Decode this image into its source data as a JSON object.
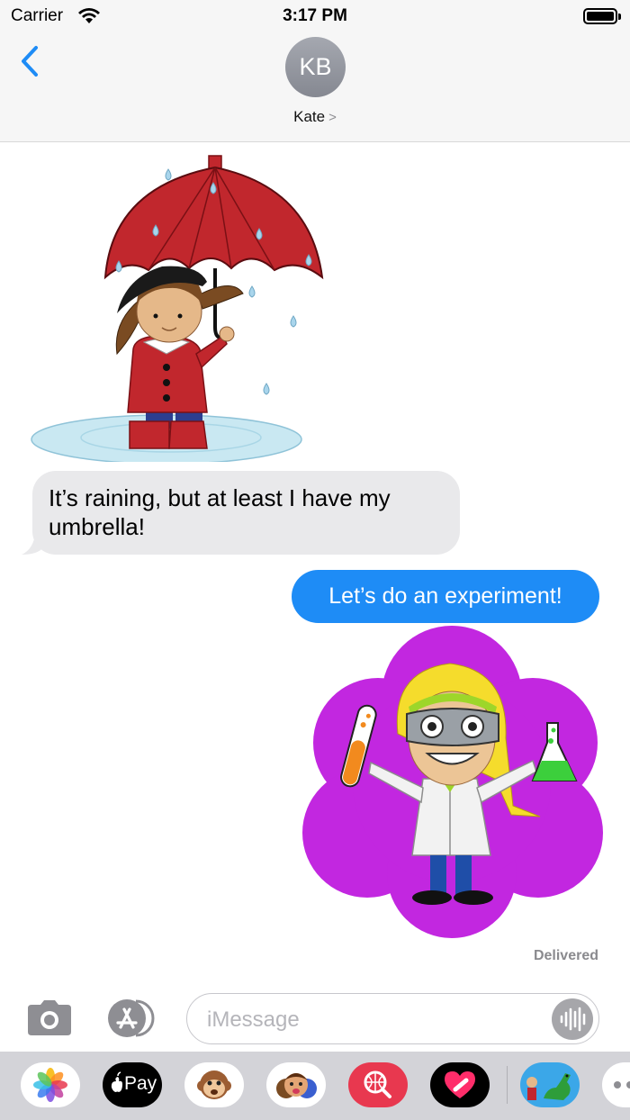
{
  "status_bar": {
    "carrier": "Carrier",
    "time": "3:17 PM"
  },
  "header": {
    "avatar_initials": "KB",
    "contact_name": "Kate",
    "chevron": ">"
  },
  "messages": [
    {
      "type": "sticker",
      "direction": "incoming",
      "subject": "girl-with-umbrella"
    },
    {
      "type": "text",
      "direction": "incoming",
      "text": "It’s raining,  but at least I have my umbrella!"
    },
    {
      "type": "text",
      "direction": "outgoing",
      "text": "Let’s do an experiment!"
    },
    {
      "type": "sticker",
      "direction": "outgoing",
      "subject": "scientist-girl"
    }
  ],
  "status": {
    "delivered": "Delivered"
  },
  "compose": {
    "placeholder": "iMessage"
  },
  "app_drawer": {
    "apps": [
      {
        "icon": "photos-icon"
      },
      {
        "icon": "apple-pay-icon",
        "label": "Pay"
      },
      {
        "icon": "animoji-icon"
      },
      {
        "icon": "memoji-icon"
      },
      {
        "icon": "web-search-icon"
      },
      {
        "icon": "digital-touch-icon"
      },
      {
        "icon": "sticker-pack-icon"
      },
      {
        "icon": "more-icon"
      }
    ]
  },
  "colors": {
    "ios_blue": "#1e8cf6",
    "incoming_bubble": "#e9e9eb",
    "umbrella_red": "#c1272d",
    "sticker_purple": "#c227e0"
  }
}
